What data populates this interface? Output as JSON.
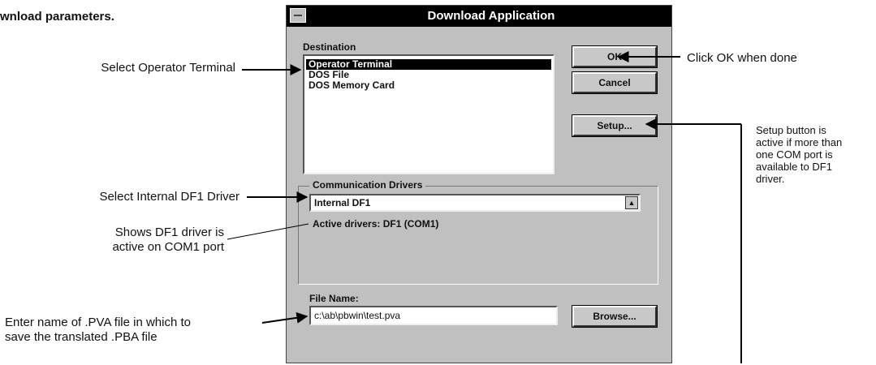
{
  "page": {
    "heading": "wnload parameters."
  },
  "dialog": {
    "title": "Download Application",
    "destination_label": "Destination",
    "destinations": [
      "Operator Terminal",
      "DOS File",
      "DOS Memory Card"
    ],
    "selected_destination": "Operator Terminal",
    "ok_label": "OK",
    "cancel_label": "Cancel",
    "setup_label": "Setup...",
    "comm_group_label": "Communication Drivers",
    "driver_value": "Internal DF1",
    "active_drivers": "Active drivers: DF1 (COM1)",
    "file_name_label": "File Name:",
    "file_name_value": "c:\\ab\\pbwin\\test.pva",
    "browse_label": "Browse..."
  },
  "callouts": {
    "select_terminal": "Select Operator Terminal",
    "click_ok": "Click OK when done",
    "setup_note": [
      "Setup button is",
      "active if more than",
      "one COM port is",
      "available to DF1",
      "driver."
    ],
    "select_driver": "Select Internal DF1 Driver",
    "shows_driver": [
      "Shows DF1 driver is",
      "active on COM1 port"
    ],
    "enter_name": [
      "Enter name of .PVA file in which to",
      "save the translated .PBA file"
    ]
  }
}
